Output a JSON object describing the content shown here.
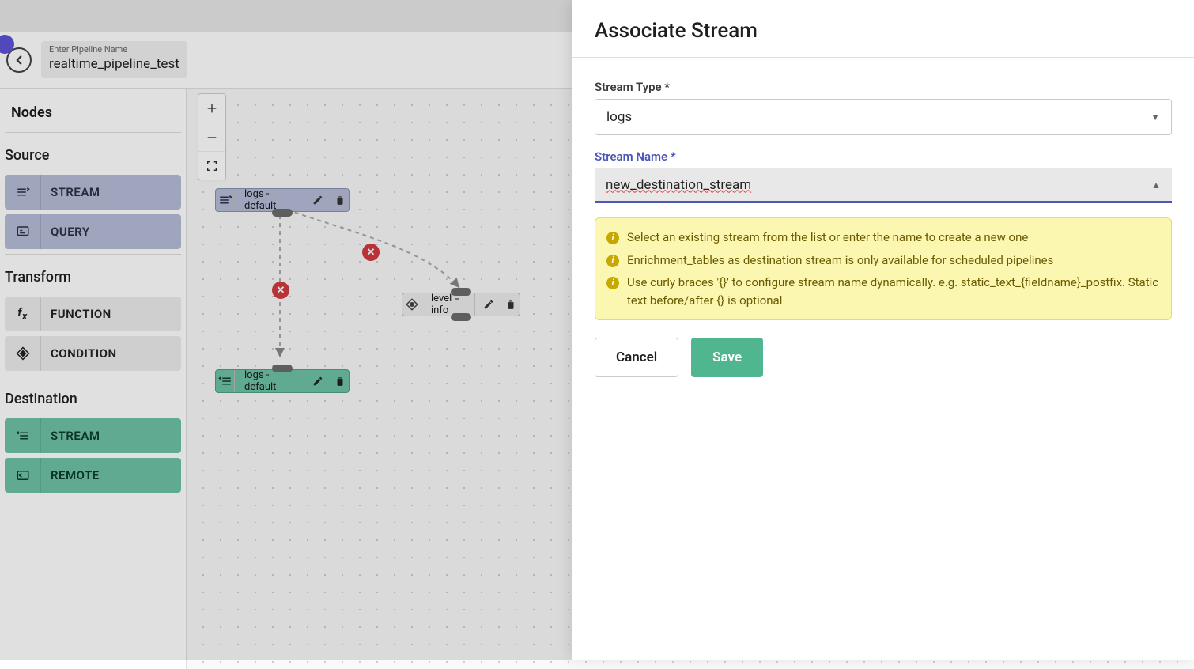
{
  "pipeline": {
    "name_label": "Enter Pipeline Name",
    "name_value": "realtime_pipeline_test"
  },
  "sidebar": {
    "heading": "Nodes",
    "sections": {
      "source": {
        "label": "Source",
        "items": [
          "STREAM",
          "QUERY"
        ]
      },
      "transform": {
        "label": "Transform",
        "items": [
          "FUNCTION",
          "CONDITION"
        ]
      },
      "destination": {
        "label": "Destination",
        "items": [
          "STREAM",
          "REMOTE"
        ]
      }
    }
  },
  "canvas": {
    "source_node_label": "logs - default",
    "condition_node_label": "level = info",
    "dest_node_label": "logs - default"
  },
  "drawer": {
    "title": "Associate Stream",
    "stream_type_label": "Stream Type *",
    "stream_type_value": "logs",
    "stream_name_label": "Stream Name *",
    "stream_name_value": "new_destination_stream",
    "info": [
      "Select an existing stream from the list or enter the name to create a new one",
      "Enrichment_tables as destination stream is only available for scheduled pipelines",
      "Use curly braces '{}' to configure stream name dynamically. e.g. static_text_{fieldname}_postfix. Static text before/after {} is optional"
    ],
    "cancel_label": "Cancel",
    "save_label": "Save"
  }
}
